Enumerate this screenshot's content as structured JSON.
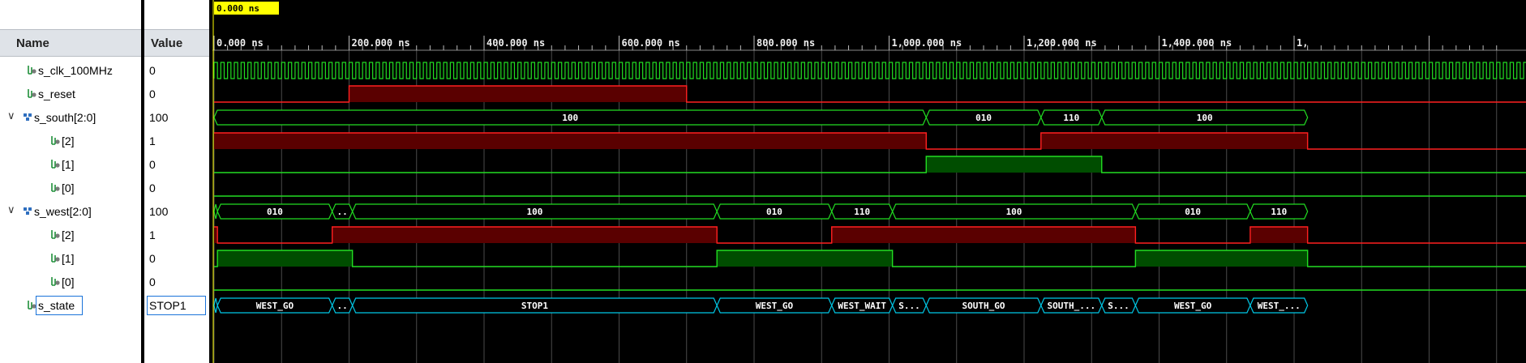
{
  "cursor_time": "0.000 ns",
  "header": {
    "name_label": "Name",
    "value_label": "Value"
  },
  "timeline": {
    "ticks": [
      "0.000 ns",
      "200.000 ns",
      "400.000 ns",
      "600.000 ns",
      "800.000 ns",
      "1,000.000 ns",
      "1,200.000 ns",
      "1,400.000 ns",
      "1,"
    ]
  },
  "signals": [
    {
      "name": "s_clk_100MHz",
      "value": "0",
      "kind": "bit",
      "indent": 1
    },
    {
      "name": "s_reset",
      "value": "0",
      "kind": "bit",
      "indent": 1
    },
    {
      "name": "s_south[2:0]",
      "value": "100",
      "kind": "bus",
      "indent": 0
    },
    {
      "name": "[2]",
      "value": "1",
      "kind": "bit",
      "indent": 2
    },
    {
      "name": "[1]",
      "value": "0",
      "kind": "bit",
      "indent": 2
    },
    {
      "name": "[0]",
      "value": "0",
      "kind": "bit",
      "indent": 2
    },
    {
      "name": "s_west[2:0]",
      "value": "100",
      "kind": "bus",
      "indent": 0
    },
    {
      "name": "[2]",
      "value": "1",
      "kind": "bit",
      "indent": 2
    },
    {
      "name": "[1]",
      "value": "0",
      "kind": "bit",
      "indent": 2
    },
    {
      "name": "[0]",
      "value": "0",
      "kind": "bit",
      "indent": 2
    },
    {
      "name": "s_state",
      "value": "STOP1",
      "kind": "state",
      "indent": 1
    }
  ],
  "waveforms": {
    "time_unit": "ns",
    "clock_period": 10,
    "reset_high": [
      [
        200,
        700
      ]
    ],
    "south_bus": [
      {
        "t0": 0,
        "t1": 1055,
        "label": "100"
      },
      {
        "t0": 1055,
        "t1": 1225,
        "label": "010"
      },
      {
        "t0": 1225,
        "t1": 1315,
        "label": "110"
      },
      {
        "t0": 1315,
        "t1": 1620,
        "label": "100"
      }
    ],
    "south_bits": {
      "b2_high": [
        [
          0,
          1055
        ],
        [
          1225,
          1620
        ]
      ],
      "b1_high": [
        [
          1055,
          1315
        ]
      ],
      "b0_high": []
    },
    "west_bus": [
      {
        "t0": 0,
        "t1": 5,
        "label": ""
      },
      {
        "t0": 5,
        "t1": 175,
        "label": "010"
      },
      {
        "t0": 175,
        "t1": 205,
        "label": ".."
      },
      {
        "t0": 205,
        "t1": 745,
        "label": "100"
      },
      {
        "t0": 745,
        "t1": 915,
        "label": "010"
      },
      {
        "t0": 915,
        "t1": 1005,
        "label": "110"
      },
      {
        "t0": 1005,
        "t1": 1365,
        "label": "100"
      },
      {
        "t0": 1365,
        "t1": 1535,
        "label": "010"
      },
      {
        "t0": 1535,
        "t1": 1620,
        "label": "110"
      }
    ],
    "west_bits": {
      "b2_high": [
        [
          0,
          5
        ],
        [
          175,
          745
        ],
        [
          915,
          1365
        ],
        [
          1535,
          1620
        ]
      ],
      "b1_high": [
        [
          5,
          205
        ],
        [
          745,
          1005
        ],
        [
          1365,
          1620
        ]
      ],
      "b0_high": []
    },
    "state_bus": [
      {
        "t0": 0,
        "t1": 5,
        "label": ""
      },
      {
        "t0": 5,
        "t1": 175,
        "label": "WEST_GO"
      },
      {
        "t0": 175,
        "t1": 205,
        "label": ".."
      },
      {
        "t0": 205,
        "t1": 745,
        "label": "STOP1"
      },
      {
        "t0": 745,
        "t1": 915,
        "label": "WEST_GO"
      },
      {
        "t0": 915,
        "t1": 1005,
        "label": "WEST_WAIT"
      },
      {
        "t0": 1005,
        "t1": 1055,
        "label": "S..."
      },
      {
        "t0": 1055,
        "t1": 1225,
        "label": "SOUTH_GO"
      },
      {
        "t0": 1225,
        "t1": 1315,
        "label": "SOUTH_..."
      },
      {
        "t0": 1315,
        "t1": 1365,
        "label": "S..."
      },
      {
        "t0": 1365,
        "t1": 1535,
        "label": "WEST_GO"
      },
      {
        "t0": 1535,
        "t1": 1620,
        "label": "WEST_..."
      }
    ]
  },
  "colors": {
    "bit_high_fill": "#5a0000",
    "bit_high_line": "#ff2020",
    "bit_low_line": "#ff2020",
    "green_line": "#22dd22",
    "green_fill": "#004d00",
    "bus_outline": "#22dd22",
    "state_outline": "#00c8e6",
    "grid": "#4a4a4a",
    "cursor_label_bg": "#ffff00"
  }
}
